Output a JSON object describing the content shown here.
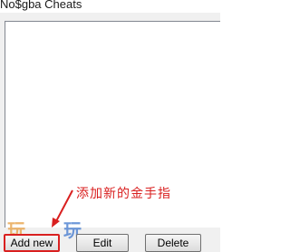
{
  "window": {
    "title": "No$gba Cheats"
  },
  "list": {
    "items": []
  },
  "buttons": {
    "add_new": "Add new",
    "edit": "Edit",
    "delete": "Delete"
  },
  "annotation": {
    "text": "添加新的金手指",
    "color": "#d92020"
  },
  "watermark": {
    "left": "玩",
    "right": "玩"
  }
}
